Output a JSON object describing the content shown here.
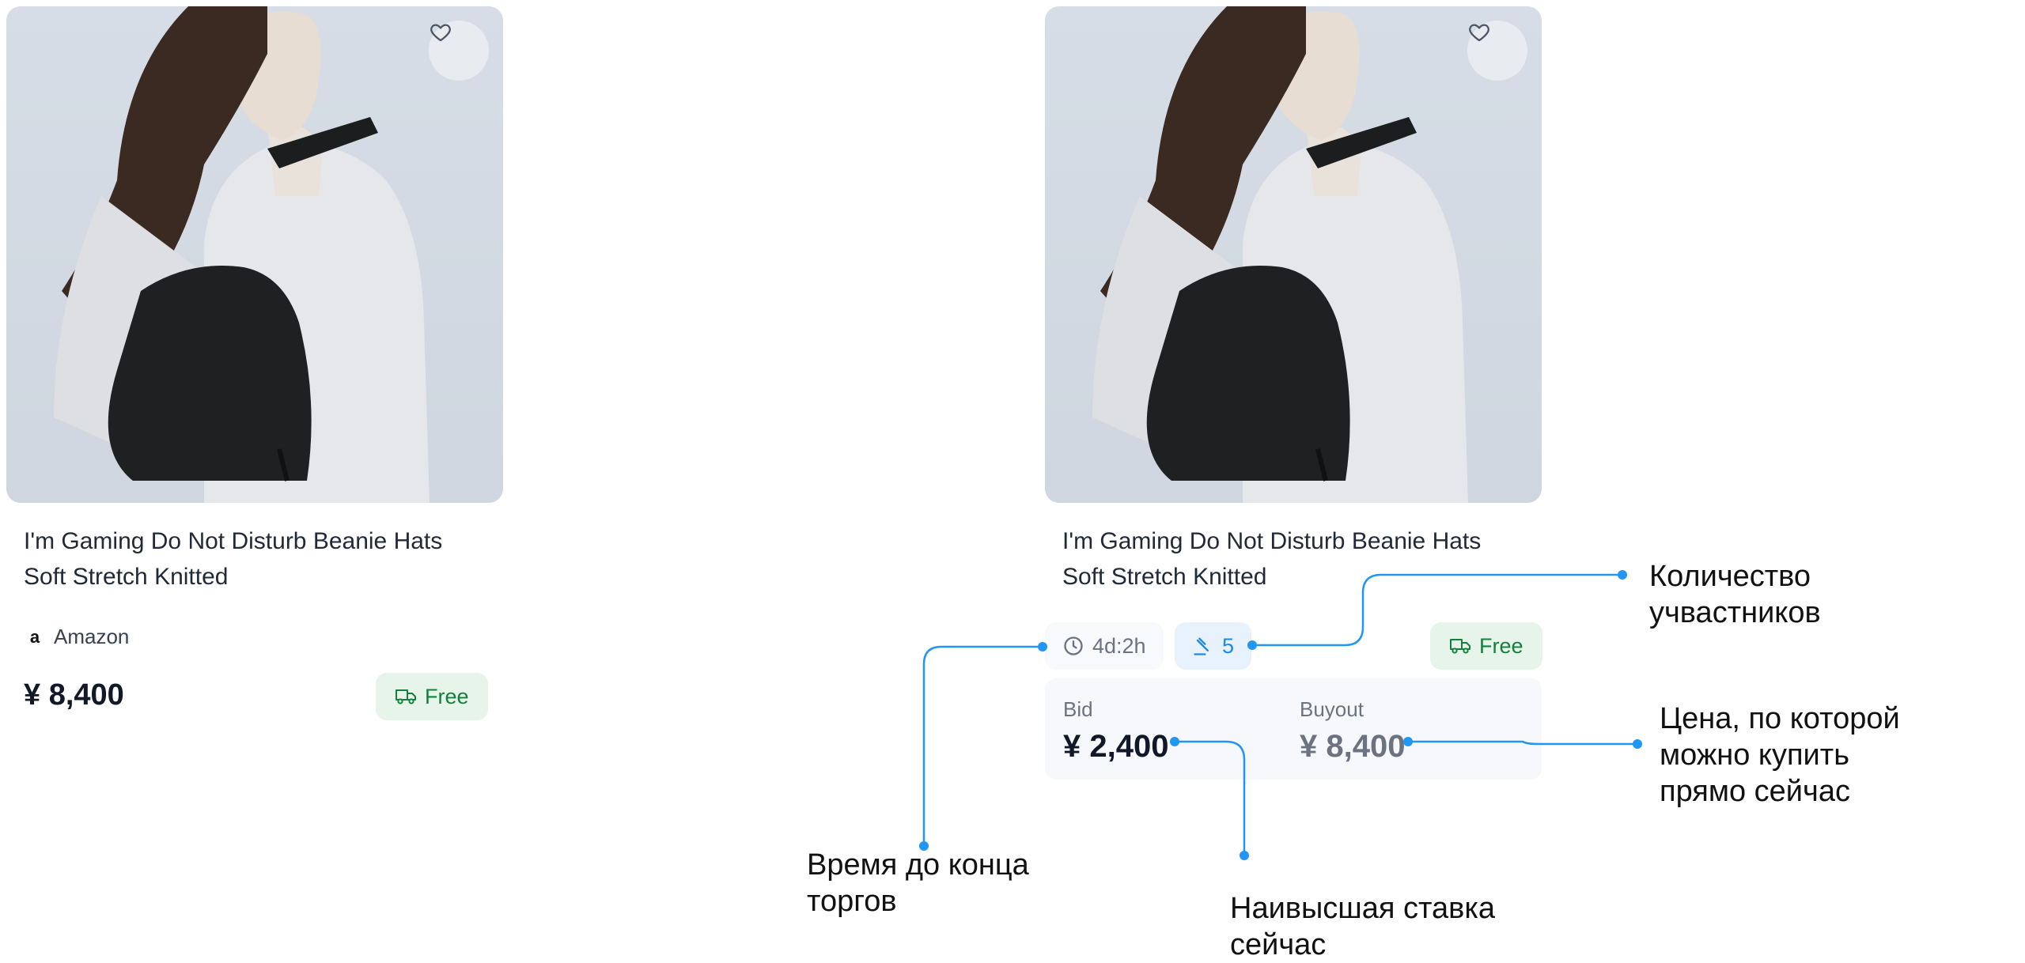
{
  "colors": {
    "accent": "#2196f3",
    "free_green": "#15803d",
    "free_bg": "#e6f4ea",
    "bid_chip_bg": "#e7f2fd"
  },
  "card_left": {
    "title": "I'm Gaming Do Not Disturb Beanie Hats Soft Stretch Knitted",
    "store": "Amazon",
    "store_icon": "amazon-logo-icon",
    "price": "¥ 8,400",
    "shipping": "Free",
    "shipping_icon": "truck-icon",
    "favorite_icon": "heart-icon"
  },
  "card_right": {
    "title": "I'm Gaming Do Not Disturb Beanie Hats Soft Stretch Knitted",
    "time_left": "4d:2h",
    "time_icon": "clock-icon",
    "bidders": "5",
    "bidders_icon": "auction-hammer-icon",
    "shipping": "Free",
    "shipping_icon": "truck-icon",
    "bid_label": "Bid",
    "bid_value": "¥ 2,400",
    "buyout_label": "Buyout",
    "buyout_value": "¥ 8,400",
    "favorite_icon": "heart-icon"
  },
  "annotations": {
    "participants": "Количество\nучвастников",
    "buyout": "Цена, по которой\nможно купить\nпрямо сейчас",
    "time": "Время до конца\nторгов",
    "highest_bid": "Наивысшая ставка\nсейчас"
  }
}
